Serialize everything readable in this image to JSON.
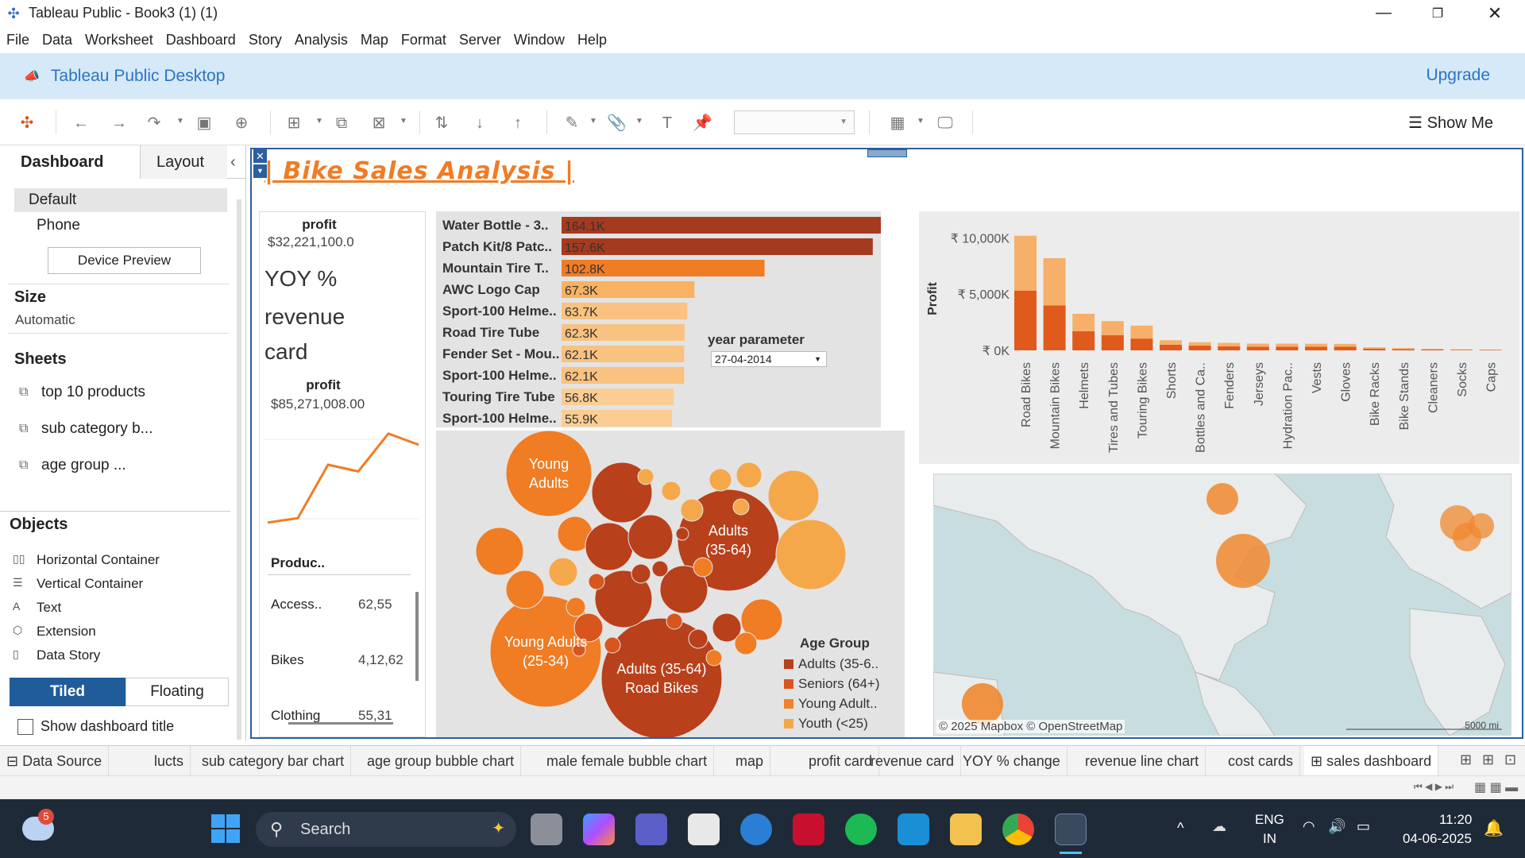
{
  "window": {
    "title": "Tableau Public - Book3 (1) (1)"
  },
  "menu": [
    "File",
    "Data",
    "Worksheet",
    "Dashboard",
    "Story",
    "Analysis",
    "Map",
    "Format",
    "Server",
    "Window",
    "Help"
  ],
  "banner": {
    "title": "Tableau Public Desktop",
    "upgrade": "Upgrade"
  },
  "toolbar": {
    "show_me": "Show Me"
  },
  "left_panel": {
    "tab_dashboard": "Dashboard",
    "tab_layout": "Layout",
    "device_default": "Default",
    "device_phone": "Phone",
    "device_preview": "Device Preview",
    "size_heading": "Size",
    "size_value": "Automatic",
    "sheets_heading": "Sheets",
    "sheets": [
      "top 10 products",
      "sub category b...",
      "age group ..."
    ],
    "objects_heading": "Objects",
    "objects": [
      "Horizontal Container",
      "Vertical Container",
      "Text",
      "Extension",
      "Data Story"
    ],
    "tiled": "Tiled",
    "floating": "Floating",
    "show_title": "Show dashboard title"
  },
  "dashboard": {
    "title": "| Bike Sales Analysis |",
    "profit_label_1": "profit",
    "profit_value_1": "$32,221,100.0",
    "yoy_text": "YOY %",
    "revenue_text": "revenue",
    "card_text": "card",
    "profit_label_2": "profit",
    "profit_value_2": "$85,271,008.00",
    "product_header": "Produc..",
    "product_rows": [
      {
        "name": "Access..",
        "value": "62,55"
      },
      {
        "name": "Bikes",
        "value": "4,12,62"
      },
      {
        "name": "Clothing",
        "value": "55,31"
      }
    ],
    "year_param_label": "year parameter",
    "year_param_value": "27-04-2014",
    "legend_title": "Age Group",
    "legend_items": [
      {
        "label": "Adults (35-6..",
        "color": "#b8401b"
      },
      {
        "label": "Seniors (64+)",
        "color": "#d9551e"
      },
      {
        "label": "Young Adult..",
        "color": "#f0822a"
      },
      {
        "label": "Youth (<25)",
        "color": "#f5a84a"
      }
    ],
    "bubble_labels": {
      "young_adults": "Young Adults",
      "adults": "Adults (35-64)",
      "young_adults_25_34": "Young Adults (25-34)",
      "adults_road_bikes": "Adults (35-64) Road Bikes"
    },
    "map_attribution": "© 2025 Mapbox © OpenStreetMap",
    "map_scale": "5000 mi"
  },
  "chart_data": [
    {
      "type": "bar",
      "orientation": "horizontal",
      "categories": [
        "Water Bottle - 3..",
        "Patch Kit/8 Patc..",
        "Mountain Tire T..",
        "AWC Logo Cap",
        "Sport-100 Helme..",
        "Road Tire Tube",
        "Fender Set - Mou..",
        "Sport-100 Helme..",
        "Touring Tire Tube",
        "Sport-100 Helme.."
      ],
      "values": [
        164.1,
        157.6,
        102.8,
        67.3,
        63.7,
        62.3,
        62.1,
        62.1,
        56.8,
        55.9
      ],
      "value_labels": [
        "164.1K",
        "157.6K",
        "102.8K",
        "67.3K",
        "63.7K",
        "62.3K",
        "62.1K",
        "62.1K",
        "56.8K",
        "55.9K"
      ],
      "colors": [
        "#a63a1e",
        "#a63a1e",
        "#f07c24",
        "#f8b261",
        "#f9c280",
        "#f9c280",
        "#f9c280",
        "#f9c280",
        "#fbcd92",
        "#fbcd92"
      ]
    },
    {
      "type": "bar",
      "stacked": true,
      "ylabel": "Profit",
      "yticks": [
        "₹ 10,000K",
        "₹ 5,000K",
        "₹ 0K"
      ],
      "ylim": [
        0,
        10600
      ],
      "categories": [
        "Road Bikes",
        "Mountain Bikes",
        "Helmets",
        "Tires and Tubes",
        "Touring Bikes",
        "Shorts",
        "Bottles and Ca..",
        "Fenders",
        "Jerseys",
        "Hydration Pac..",
        "Vests",
        "Gloves",
        "Bike Racks",
        "Bike Stands",
        "Cleaners",
        "Socks",
        "Caps"
      ],
      "series": [
        {
          "values": [
            5300,
            4000,
            1700,
            1350,
            1050,
            500,
            420,
            360,
            330,
            330,
            320,
            320,
            150,
            110,
            80,
            50,
            40
          ],
          "color": "#e05a1c"
        },
        {
          "values": [
            4900,
            4200,
            1550,
            1250,
            1150,
            400,
            300,
            300,
            270,
            270,
            270,
            260,
            120,
            90,
            60,
            40,
            30
          ],
          "color": "#f6b06a"
        }
      ]
    },
    {
      "type": "line",
      "values": [
        8,
        12,
        60,
        54,
        88,
        78
      ]
    }
  ],
  "sheet_tabs": [
    "Data Source",
    "lucts",
    "sub category bar chart",
    "age group bubble chart",
    "male female bubble chart",
    "map",
    "profit card",
    "revenue card",
    "YOY % change",
    "revenue line chart",
    "cost cards",
    "sales dashboard"
  ],
  "taskbar": {
    "search": "Search",
    "lang1": "ENG",
    "lang2": "IN",
    "time": "11:20",
    "date": "04-06-2025",
    "weather_badge": "5"
  }
}
